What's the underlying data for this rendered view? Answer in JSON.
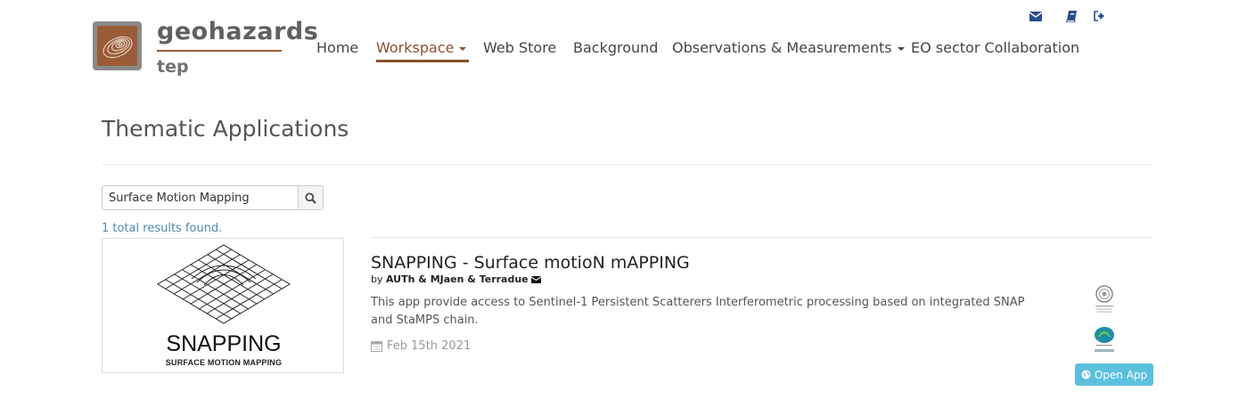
{
  "header": {
    "logo_title": "geohazards",
    "logo_subtitle": "tep",
    "util_icons": [
      "envelope-icon",
      "book-icon",
      "sign-out-icon"
    ],
    "nav": [
      {
        "label": "Home",
        "dropdown": false,
        "active": false
      },
      {
        "label": "Workspace",
        "dropdown": true,
        "active": true
      },
      {
        "label": "Web Store",
        "dropdown": false,
        "active": false
      },
      {
        "label": "Background",
        "dropdown": false,
        "active": false
      },
      {
        "label": "Observations & Measurements",
        "dropdown": true,
        "active": false
      },
      {
        "label": "EO sector Collaboration",
        "dropdown": false,
        "active": false
      }
    ]
  },
  "page": {
    "title": "Thematic Applications"
  },
  "search": {
    "value": "Surface Motion Mapping",
    "icon": "search-icon",
    "results_text": "1 total results found."
  },
  "results": [
    {
      "thumbnail_title": "SNAPPING",
      "thumbnail_subtitle": "SURFACE MOTION MAPPING",
      "title": "SNAPPING - Surface motioN mAPPING",
      "by_prefix": "by",
      "authors": "AUTh & MJaen & Terradue",
      "description": "This app provide access to Sentinel-1 Persistent Scatterers Interferometric processing based on integrated SNAP and StaMPS chain.",
      "date": "Feb 15th 2021",
      "partner_logos": [
        "Aristotle University of Thessaloniki",
        "Terradue"
      ],
      "open_label": "Open App"
    }
  ],
  "colors": {
    "brand": "#8c4f2d",
    "link": "#4a8ab0",
    "button": "#5bc0de",
    "icon": "#2a4d8f"
  }
}
